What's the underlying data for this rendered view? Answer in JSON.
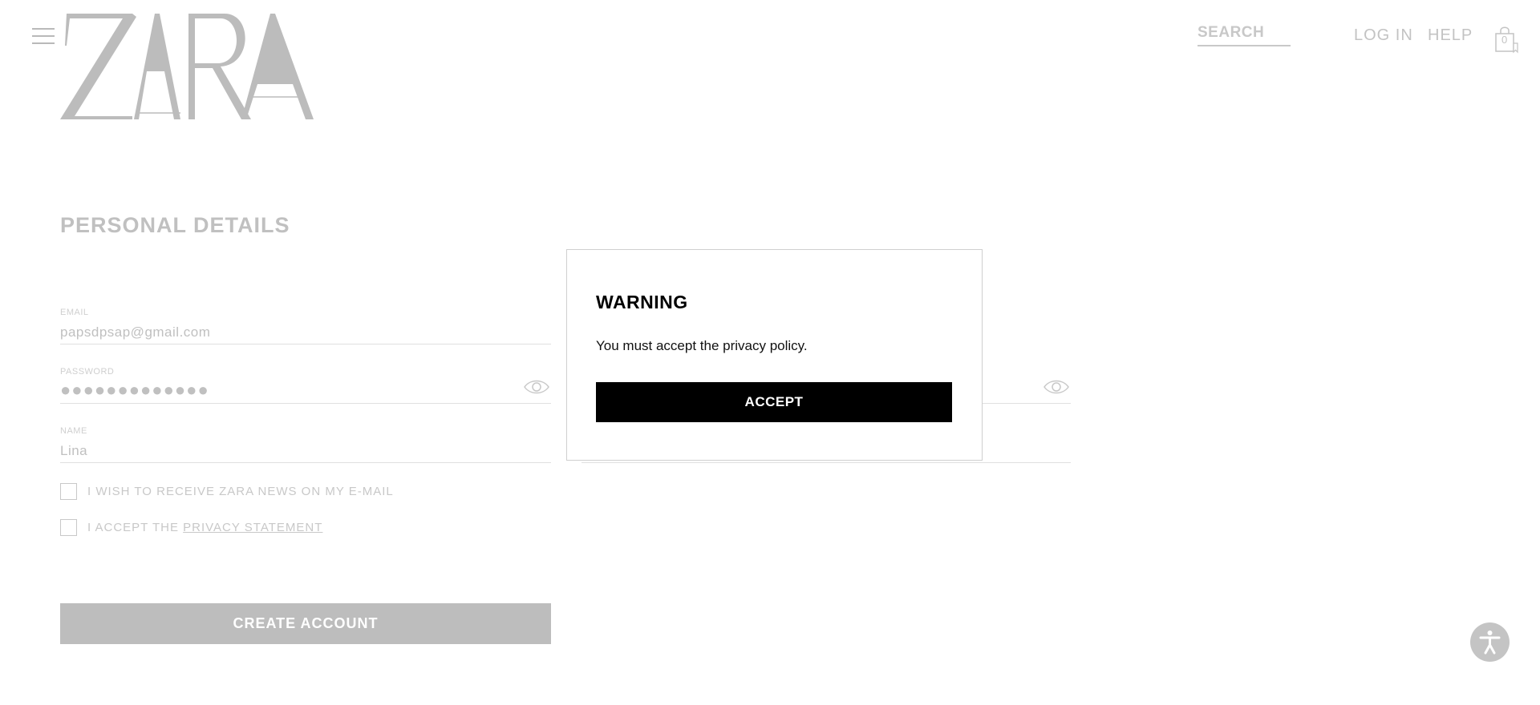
{
  "header": {
    "logo_text": "ZARA",
    "search_placeholder": "SEARCH",
    "login_label": "LOG IN",
    "help_label": "HELP",
    "bag_count": "0"
  },
  "form": {
    "title": "PERSONAL DETAILS",
    "email_label": "EMAIL",
    "email_value": "papsdpsap@gmail.com",
    "password_label": "PASSWORD",
    "password_value": "●●●●●●●●●●●●●",
    "name_label": "NAME",
    "name_value": "Lina",
    "news_checkbox_label": "I WISH TO RECEIVE ZARA NEWS ON MY E-MAIL",
    "privacy_prefix": "I ACCEPT THE",
    "privacy_link": "PRIVACY STATEMENT",
    "submit_label": "CREATE ACCOUNT"
  },
  "modal": {
    "title": "WARNING",
    "message": "You must accept the privacy policy.",
    "button_label": "ACCEPT"
  },
  "colors": {
    "accent": "#000000",
    "faded": "#c0c0c0"
  }
}
